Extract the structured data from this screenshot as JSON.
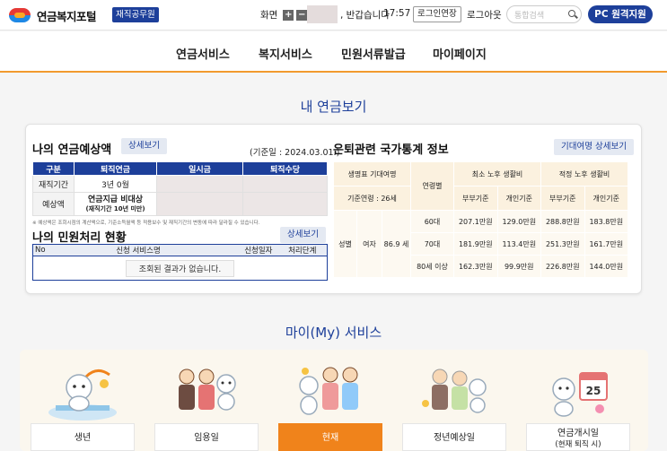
{
  "header": {
    "logo_text": "연금복지포털",
    "staff_badge": "재직공무원",
    "zoom_label": "화면",
    "zoom_in": "+",
    "zoom_out": "−",
    "greeting": ", 반갑습니다",
    "session_time": "17:57",
    "extend_label": "로그인연장",
    "logout_label": "로그아웃",
    "search_placeholder": "통합검색",
    "pc_support_label": "PC 원격지원"
  },
  "nav": {
    "items": [
      "연금서비스",
      "복지서비스",
      "민원서류발급",
      "마이페이지"
    ]
  },
  "pension": {
    "section_title": "내 연금보기",
    "estimate_title": "나의 연금예상액",
    "detail_label": "상세보기",
    "base_date": "(기준일 : 2024.03.01.)",
    "columns": [
      "구분",
      "퇴직연금",
      "일시금",
      "퇴직수당"
    ],
    "row1_label": "재직기간",
    "row1_value": "3년 0월",
    "row2_label": "예상액",
    "row2_value_line1": "연금지급 비대상",
    "row2_value_line2": "(재직기간 10년 미만)",
    "note": "※ 예상액은 조회시점의 계산액으로, 기준소득월액 등 적용보수 및 재직기간의 변동에 따라 달라질 수 있습니다."
  },
  "complaint": {
    "title": "나의 민원처리 현황",
    "detail_label": "상세보기",
    "columns": [
      "No",
      "신청 서비스명",
      "신청일자",
      "처리단계"
    ],
    "empty_message": "조회된 결과가 없습니다."
  },
  "stats": {
    "title": "은퇴관련 국가통계 정보",
    "button_label": "기대여명 상세보기",
    "h_life": "생명표 기대여명",
    "h_age_group": "연령별",
    "h_min": "최소 노후 생활비",
    "h_proper": "적정 노후 생활비",
    "h_base_age": "기준연령 : 26세",
    "h_couple": "부부기준",
    "h_single": "개인기준",
    "r_gender": "성별",
    "r_female": "여자",
    "r_life": "86.9 세",
    "rows": [
      {
        "age": "60대",
        "min_couple": "207.1만원",
        "min_single": "129.0만원",
        "pro_couple": "288.8만원",
        "pro_single": "183.8만원"
      },
      {
        "age": "70대",
        "min_couple": "181.9만원",
        "min_single": "113.4만원",
        "pro_couple": "251.3만원",
        "pro_single": "161.7만원"
      },
      {
        "age": "80세 이상",
        "min_couple": "162.3만원",
        "min_single": "99.9만원",
        "pro_couple": "226.8만원",
        "pro_single": "144.0만원"
      }
    ]
  },
  "my_service": {
    "section_title": "마이(My) 서비스",
    "items": [
      {
        "label": "생년"
      },
      {
        "label": "임용일"
      },
      {
        "label": "현재"
      },
      {
        "label": "정년예상일"
      },
      {
        "label": "연금개시일",
        "sub": "(현재 퇴직 시)"
      }
    ],
    "calendar_number": "25",
    "active_index": 2
  },
  "colors": {
    "brand_navy": "#1d3f9a",
    "accent_orange": "#f0831b",
    "nav_underline": "#f29a2e"
  }
}
